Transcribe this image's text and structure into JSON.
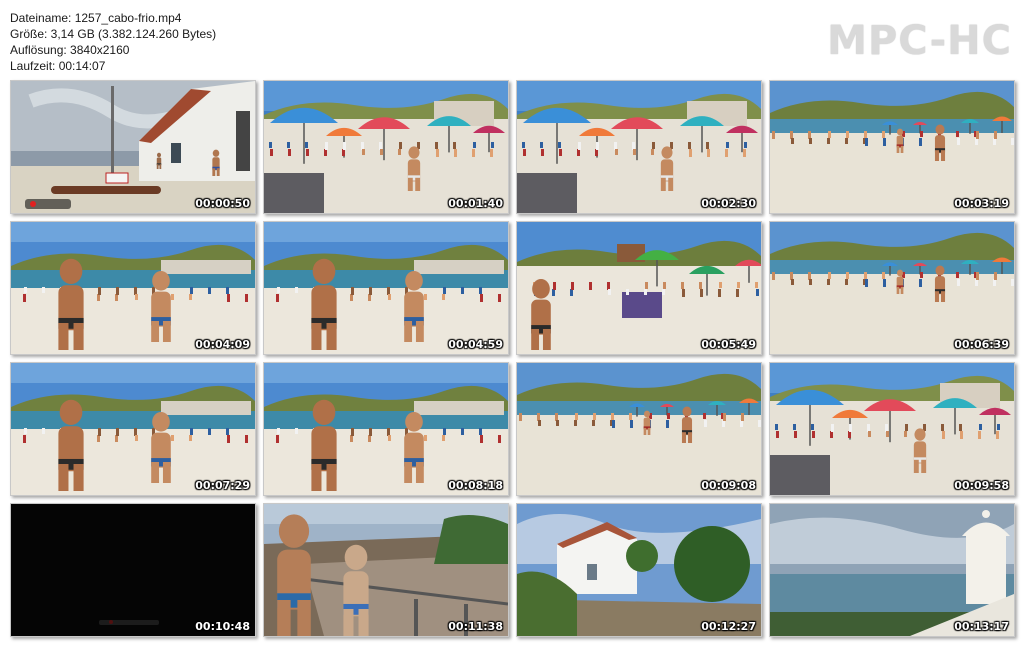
{
  "info": {
    "filename": "Dateiname: 1257_cabo-frio.mp4",
    "size": "Größe: 3,14 GB (3.382.124.260 Bytes)",
    "resolution": "Auflösung: 3840x2160",
    "duration": "Laufzeit: 00:14:07"
  },
  "logo": "MPC-HC",
  "thumbnails": [
    {
      "time": "00:00:50",
      "scene": "beach-house"
    },
    {
      "time": "00:01:40",
      "scene": "umbrellas"
    },
    {
      "time": "00:02:30",
      "scene": "umbrellas"
    },
    {
      "time": "00:03:19",
      "scene": "beach-crowd"
    },
    {
      "time": "00:04:09",
      "scene": "beach-person"
    },
    {
      "time": "00:04:59",
      "scene": "beach-person"
    },
    {
      "time": "00:05:49",
      "scene": "beach-stall"
    },
    {
      "time": "00:06:39",
      "scene": "beach-crowd"
    },
    {
      "time": "00:07:29",
      "scene": "beach-person"
    },
    {
      "time": "00:08:18",
      "scene": "beach-person"
    },
    {
      "time": "00:09:08",
      "scene": "beach-crowd"
    },
    {
      "time": "00:09:58",
      "scene": "umbrellas"
    },
    {
      "time": "00:10:48",
      "scene": "dark"
    },
    {
      "time": "00:11:38",
      "scene": "rocks"
    },
    {
      "time": "00:12:27",
      "scene": "white-building"
    },
    {
      "time": "00:13:17",
      "scene": "lookout"
    }
  ]
}
